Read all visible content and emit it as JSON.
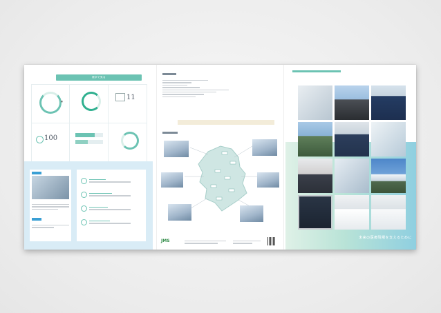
{
  "left": {
    "band_title": "数字で見る",
    "stats": [
      {
        "title": "",
        "num": ""
      },
      {
        "title": "",
        "num": ""
      },
      {
        "title": "",
        "num": "11"
      },
      {
        "title": "",
        "num": "100"
      },
      {
        "title": "",
        "num": ""
      },
      {
        "title": "",
        "num": ""
      }
    ],
    "section_heading": ""
  },
  "mid": {
    "footer_logo": "JMS"
  },
  "right": {
    "tagline": "未来の医療現場を支えるために"
  },
  "colors": {
    "accent": "#6cc3b3",
    "blue": "#3a9fd4",
    "brand_green": "#2e8a45"
  }
}
